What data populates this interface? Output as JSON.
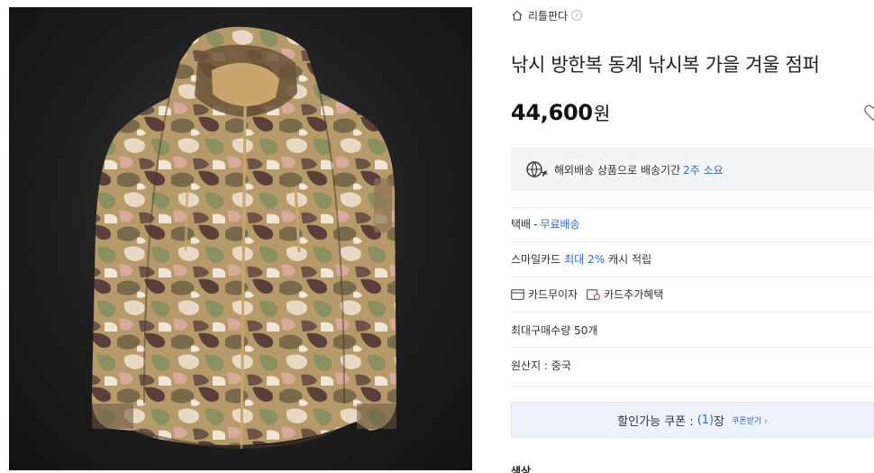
{
  "store": {
    "name": "리틀판다",
    "home_icon": "home-icon",
    "arrow_icon": "chevron-right-icon"
  },
  "product": {
    "title": "낚시 방한복 동계 낚시복 가을 겨울 점퍼",
    "price": "44,600",
    "currency": "원",
    "image_alt": "camouflage softshell hooded jacket",
    "wish_icon": "heart-icon"
  },
  "shipping": {
    "notice_prefix": "해외배송 상품으로 배송기간",
    "notice_period": "2주 소요",
    "icon": "globe-plane-icon",
    "method": "택배",
    "dash": "-",
    "fee": "무료배송"
  },
  "benefits": {
    "smile_card_label": "스마일카드",
    "smile_card_rate": "최대 2%",
    "smile_card_suffix": "캐시 적립",
    "card_interest_free": "카드무이자",
    "card_extra_benefit": "카드추가혜택"
  },
  "purchase": {
    "max_quantity": "최대구매수량 50개",
    "origin": "원산지 : 중국"
  },
  "coupon": {
    "label": "할인가능 쿠폰 :",
    "count": "(1)",
    "unit": "장",
    "more": "쿠폰받기 ›"
  },
  "option": {
    "color_label": "색상"
  },
  "colors": {
    "accent_blue": "#2e6bc6",
    "box_bg": "#f4f5f7",
    "coupon_bg": "#eef3fb"
  }
}
